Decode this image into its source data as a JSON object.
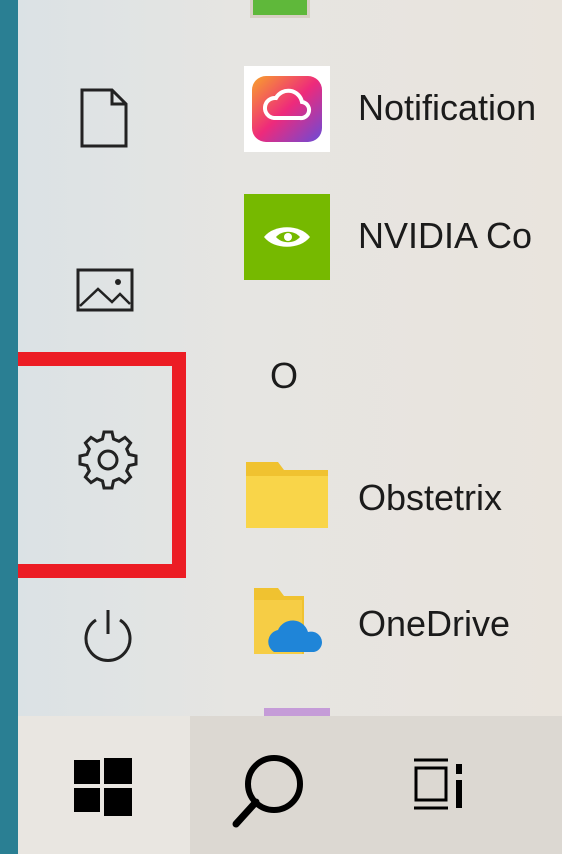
{
  "start_menu": {
    "rail": {
      "items": [
        {
          "name": "documents",
          "icon": "document-icon"
        },
        {
          "name": "pictures",
          "icon": "pictures-icon"
        },
        {
          "name": "settings",
          "icon": "gear-icon",
          "highlighted": true
        },
        {
          "name": "power",
          "icon": "power-icon"
        }
      ],
      "highlight_color": "#ec1c24"
    },
    "apps": [
      {
        "label": "Notification",
        "icon": "adobe-creative-cloud-icon"
      },
      {
        "label": "NVIDIA Co",
        "icon": "nvidia-icon"
      },
      {
        "label": "Obstetrix",
        "icon": "folder-icon"
      },
      {
        "label": "OneDrive",
        "icon": "onedrive-icon"
      }
    ],
    "section_letter": "O"
  },
  "taskbar": {
    "items": [
      {
        "name": "start",
        "icon": "windows-logo-icon"
      },
      {
        "name": "search",
        "icon": "search-icon"
      },
      {
        "name": "task-view",
        "icon": "task-view-icon"
      }
    ]
  },
  "colors": {
    "desktop": "#2a7f93",
    "nvidia_green": "#76b900",
    "highlight_red": "#ec1c24"
  }
}
